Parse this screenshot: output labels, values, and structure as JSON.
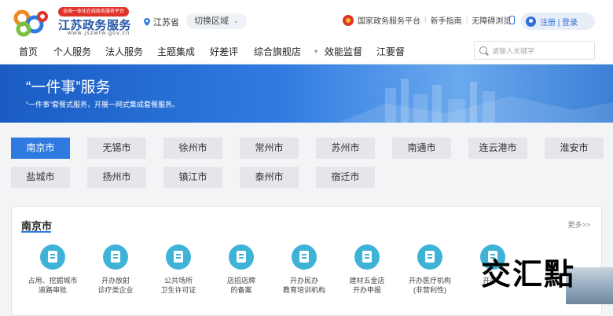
{
  "header": {
    "badge": "全国一体化在线政务服务平台",
    "site_name": "江苏政务服务",
    "site_url": "www.jszwfw.gov.cn",
    "location": "江苏省",
    "switch_region": "切换区域",
    "links": [
      "国家政务服务平台",
      "新手指南",
      "无障碍浏览"
    ],
    "login": "注册 | 登录"
  },
  "nav": {
    "items": [
      "首页",
      "个人服务",
      "法人服务",
      "主题集成",
      "好差评",
      "综合旗舰店",
      "效能监督",
      "江要督"
    ],
    "search_placeholder": "请输入关键字"
  },
  "banner": {
    "title": "“一件事”服务",
    "subtitle": "“一件事”套餐式服务，开展一网式集成套餐服务。"
  },
  "cities": {
    "selected": "南京市",
    "items": [
      "南京市",
      "无锡市",
      "徐州市",
      "常州市",
      "苏州市",
      "南通市",
      "连云港市",
      "淮安市",
      "盐城市",
      "扬州市",
      "镇江市",
      "泰州市",
      "宿迁市"
    ]
  },
  "card": {
    "title": "南京市",
    "more": "更多>>",
    "services": [
      "占用、挖掘城市\n道路审批",
      "开办放射\n诊疗类企业",
      "公共场所\n卫生许可证",
      "店招店牌\n的备案",
      "开办民办\n教育培训机构",
      "建材五金店\n开办申报",
      "开办医疗机构\n(非营利性)",
      "开办..."
    ]
  },
  "watermark": "交汇點",
  "colors": {
    "primary": "#2f7ae0",
    "brand": "#2256a6",
    "icon": "#3fb3d7",
    "badge": "#e0342b"
  }
}
